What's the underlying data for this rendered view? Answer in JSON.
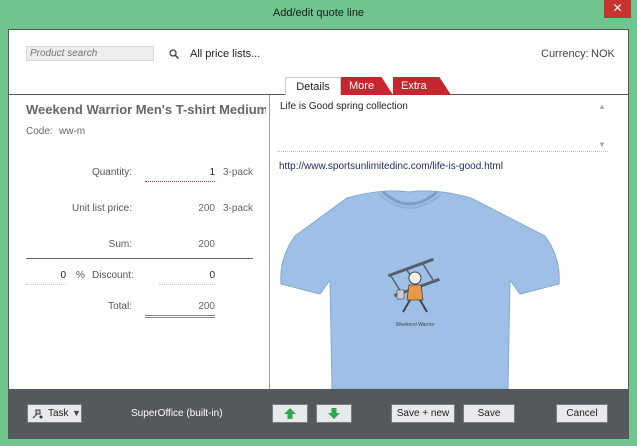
{
  "window": {
    "title": "Add/edit quote line",
    "close_label": "✕"
  },
  "search": {
    "placeholder": "Product search",
    "price_lists_label": "All price lists...",
    "currency_label": "Currency:",
    "currency_value": "NOK"
  },
  "tabs": [
    {
      "label": "Details",
      "active": true
    },
    {
      "label": "More",
      "active": false
    },
    {
      "label": "Extra",
      "active": false
    }
  ],
  "product": {
    "name": "Weekend Warrior Men's T-shirt Medium",
    "code_label": "Code:",
    "code_value": "ww-m",
    "quantity_label": "Quantity:",
    "quantity_value": "1",
    "quantity_unit": "3-pack",
    "unit_price_label": "Unit list price:",
    "unit_price_value": "200",
    "unit_price_unit": "3-pack",
    "sum_label": "Sum:",
    "sum_value": "200",
    "discount_percent": "0",
    "percent_sign": "%",
    "discount_label": "Discount:",
    "discount_value": "0",
    "total_label": "Total:",
    "total_value": "200"
  },
  "details": {
    "description": "Life is Good spring collection",
    "url": "http://www.sportsunlimitedinc.com/life-is-good.html",
    "tshirt_print": "Weekend Warrior"
  },
  "footer": {
    "task_label": "Task",
    "owner_label": "SuperOffice (built-in)",
    "save_new_label": "Save + new",
    "save_label": "Save",
    "cancel_label": "Cancel"
  },
  "colors": {
    "titlebar": "#6fc58d",
    "accent_tab": "#c6262d",
    "move_arrow": "#2fa84f",
    "tshirt": "#9ec0e6"
  }
}
